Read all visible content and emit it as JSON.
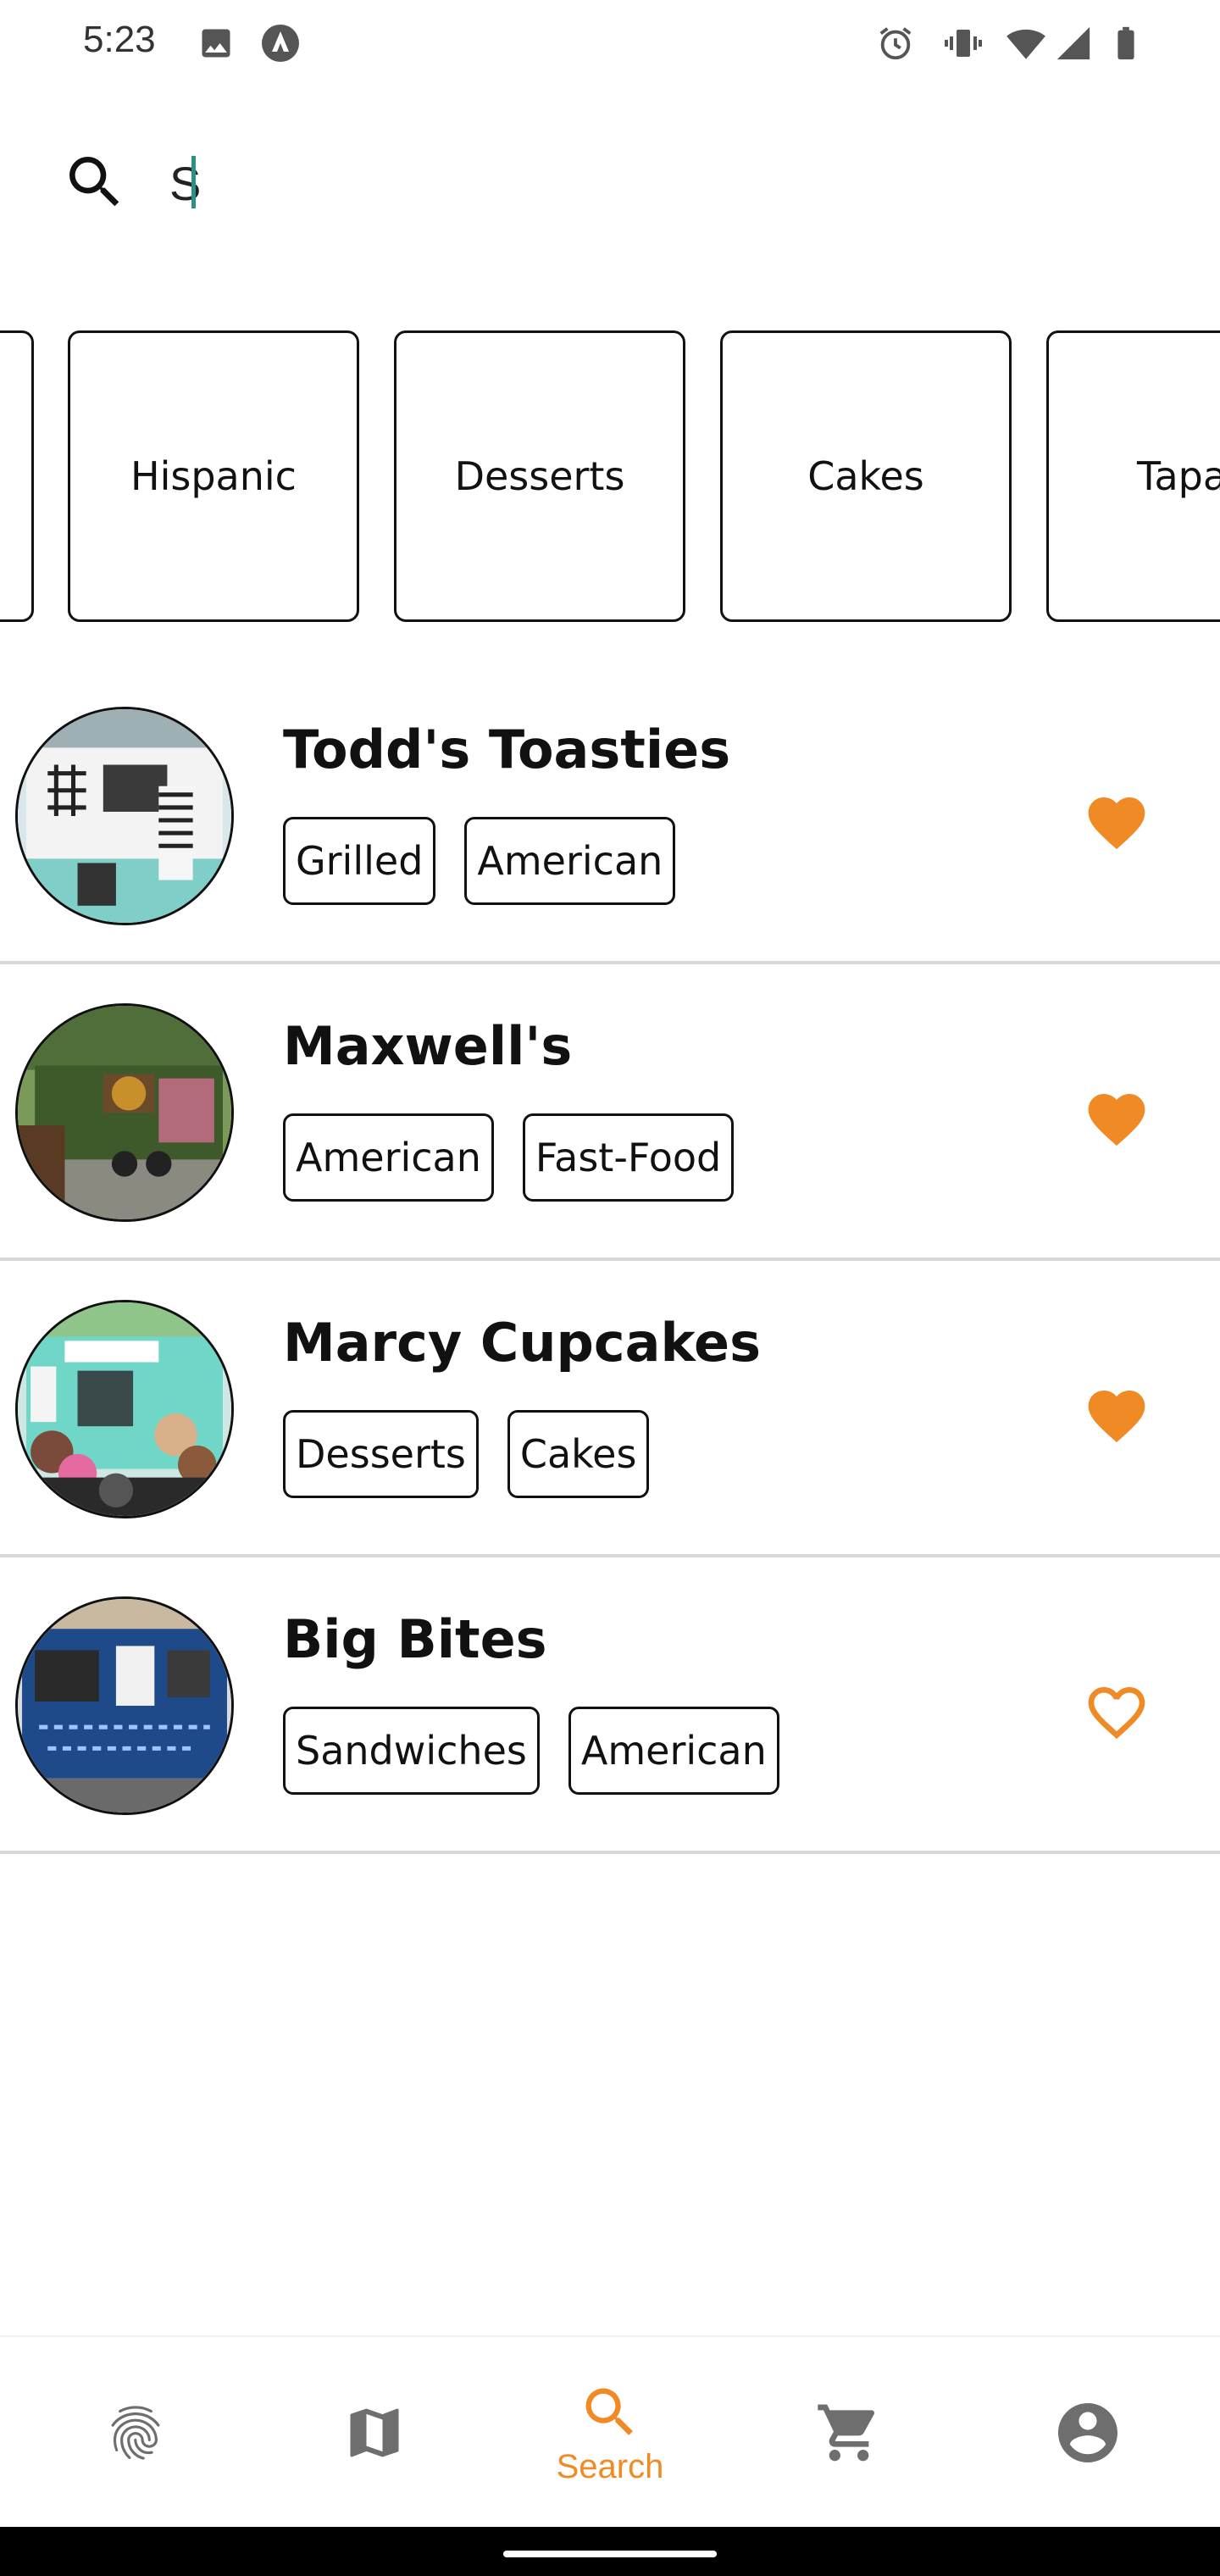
{
  "status_bar": {
    "time": "5:23",
    "icons_left": [
      "image-icon",
      "app-notification-icon"
    ],
    "icons_right": [
      "alarm-icon",
      "vibrate-icon",
      "wifi-icon",
      "signal-icon",
      "battery-icon"
    ]
  },
  "search": {
    "value": "S",
    "icon": "search-icon"
  },
  "categories": [
    {
      "label": ""
    },
    {
      "label": "Hispanic"
    },
    {
      "label": "Desserts"
    },
    {
      "label": "Cakes"
    },
    {
      "label": "Tapas"
    }
  ],
  "results": [
    {
      "name": "Todd's Toasties",
      "tags": [
        "Grilled",
        "American"
      ],
      "favorited": true
    },
    {
      "name": "Maxwell's",
      "tags": [
        "American",
        "Fast-Food"
      ],
      "favorited": true
    },
    {
      "name": "Marcy Cupcakes",
      "tags": [
        "Desserts",
        "Cakes"
      ],
      "favorited": true
    },
    {
      "name": "Big Bites",
      "tags": [
        "Sandwiches",
        "American"
      ],
      "favorited": false
    }
  ],
  "bottom_nav": {
    "items": [
      {
        "icon": "fingerprint-icon",
        "label": ""
      },
      {
        "icon": "map-icon",
        "label": ""
      },
      {
        "icon": "search-icon",
        "label": "Search",
        "active": true
      },
      {
        "icon": "cart-icon",
        "label": ""
      },
      {
        "icon": "account-icon",
        "label": ""
      }
    ]
  },
  "colors": {
    "accent": "#f08a24",
    "inactive_icon": "#6e6e6e",
    "cursor": "#2b8f8a",
    "divider": "#d8d8d8"
  }
}
